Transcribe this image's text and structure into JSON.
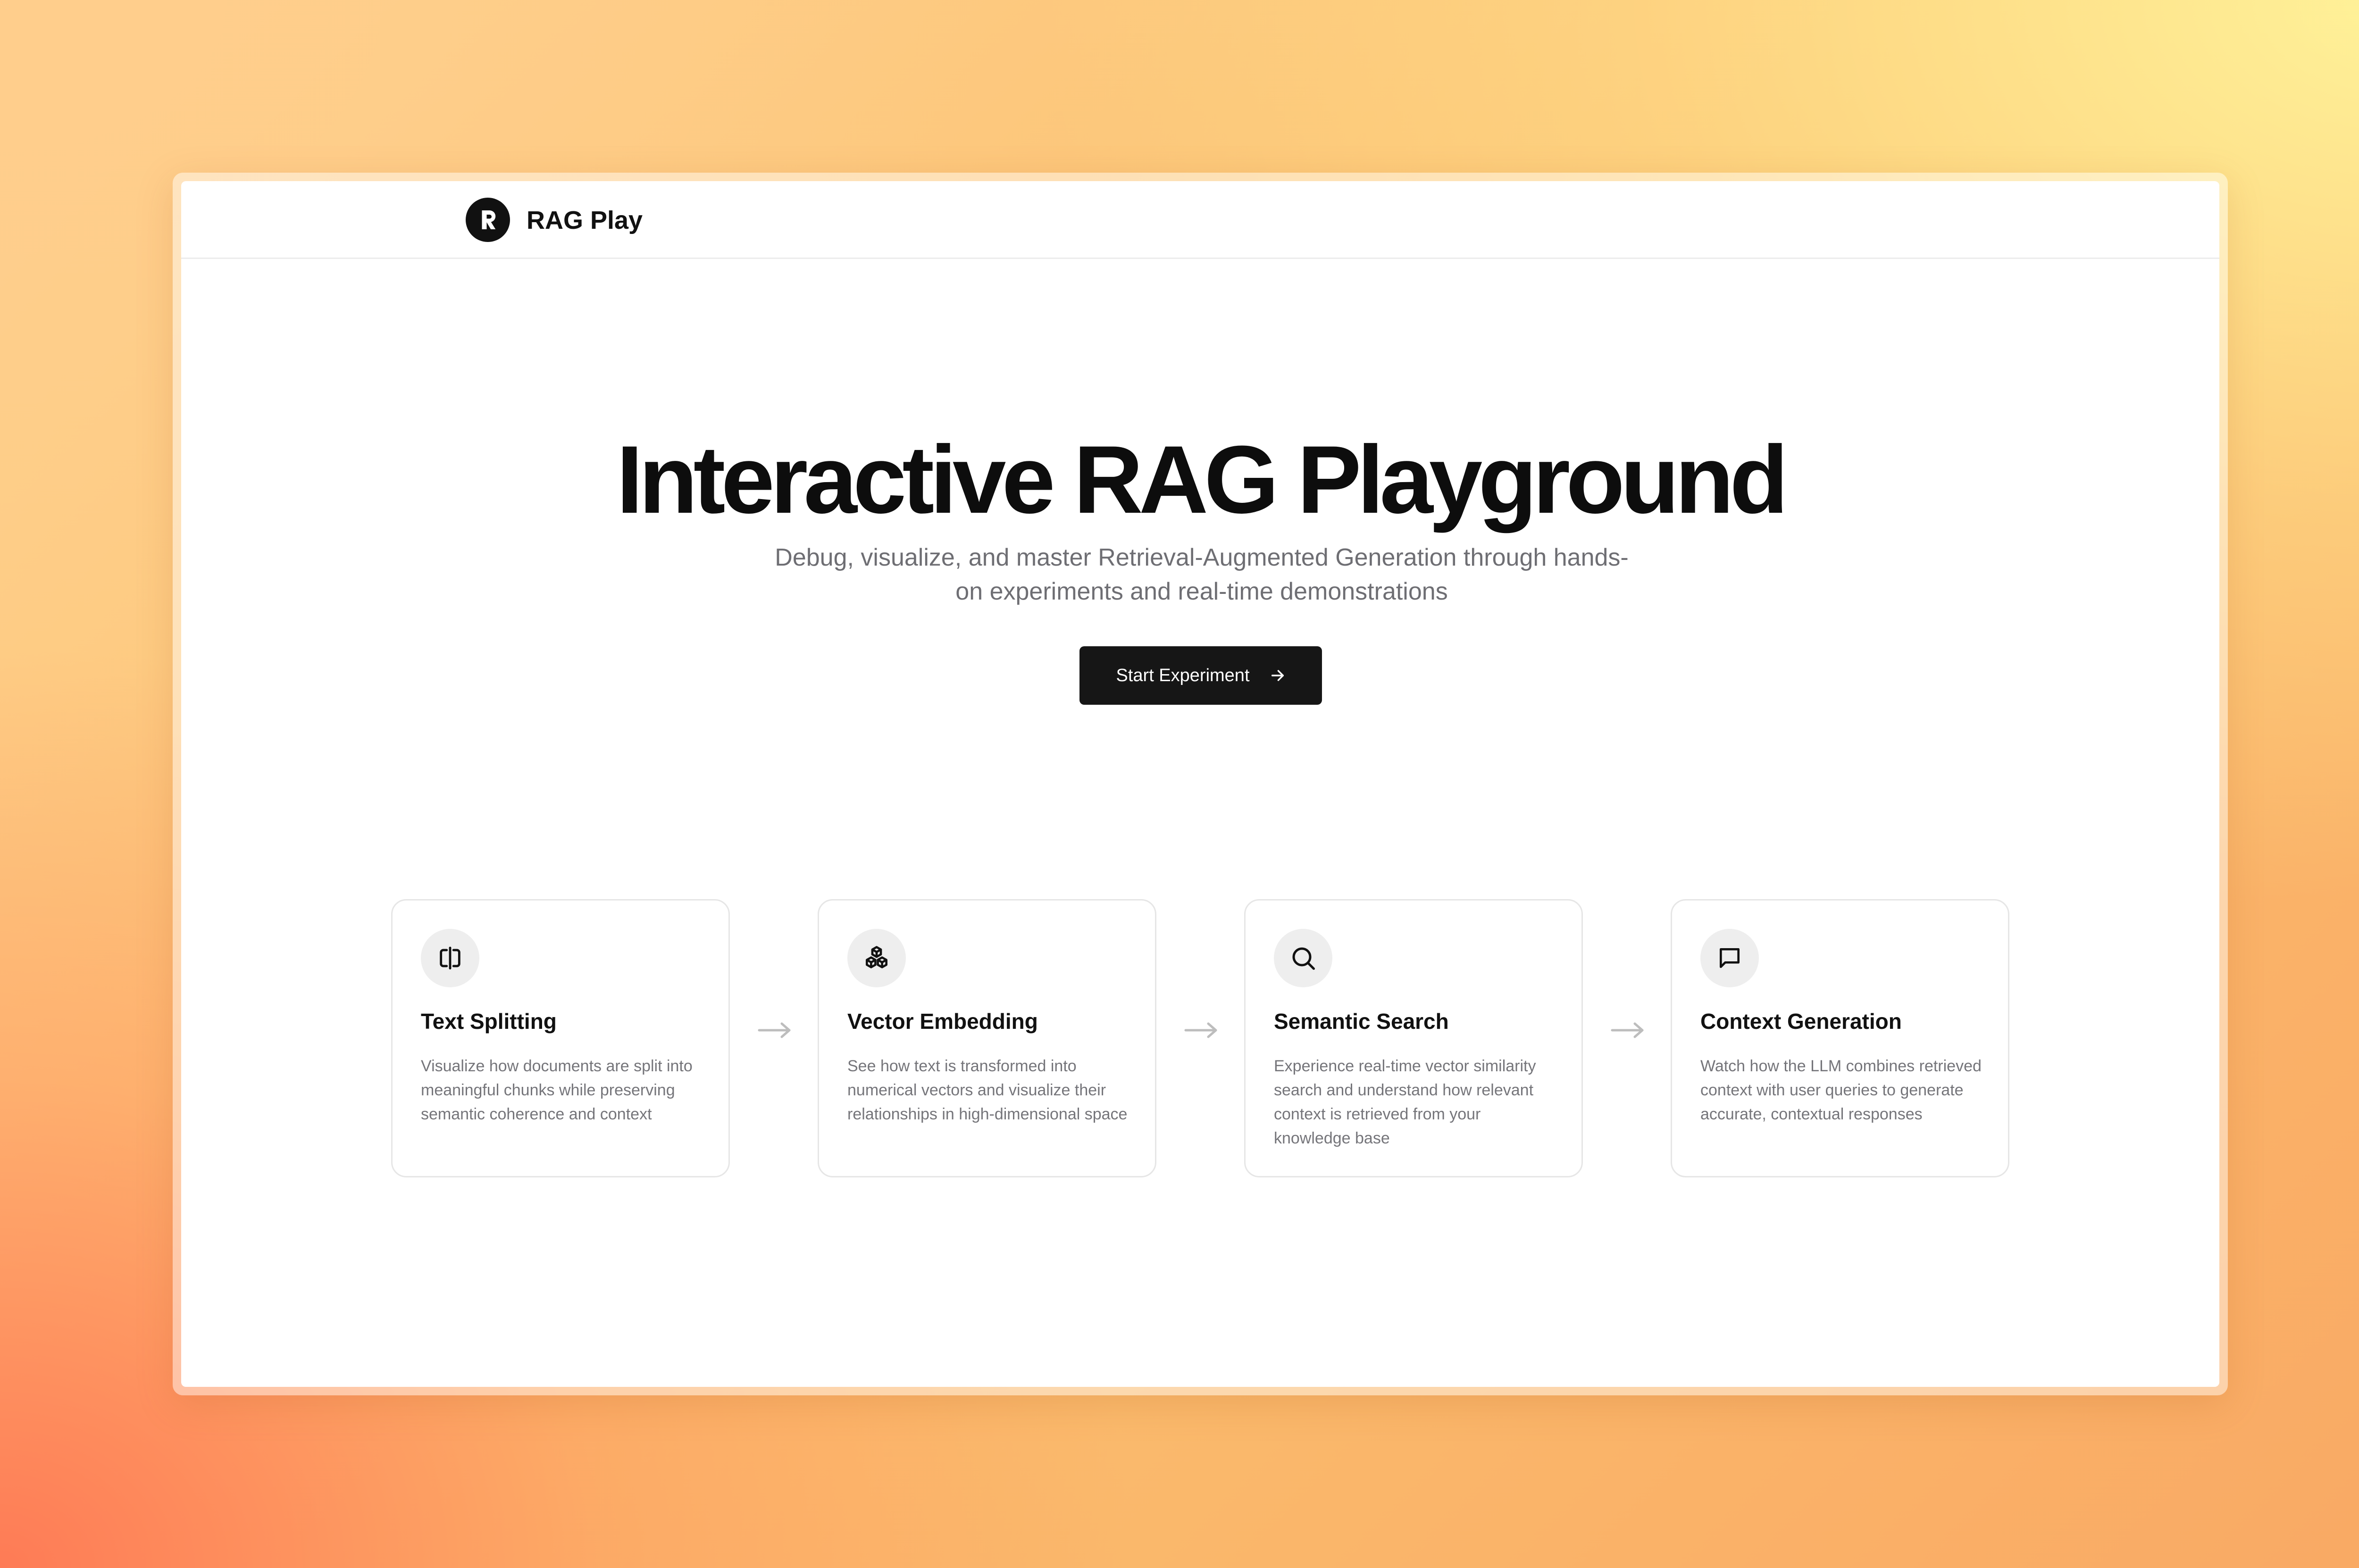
{
  "header": {
    "brand": "RAG Play",
    "logo_icon": "rag-logo-icon"
  },
  "hero": {
    "title": "Interactive RAG Playground",
    "subtitle": "Debug, visualize, and master Retrieval-Augmented Generation through hands-on experiments and real-time demonstrations",
    "cta_label": "Start Experiment",
    "cta_icon": "arrow-right-icon"
  },
  "features": [
    {
      "icon": "split-text-icon",
      "title": "Text Splitting",
      "description": "Visualize how documents are split into meaningful chunks while preserving semantic coherence and context"
    },
    {
      "icon": "embedding-cubes-icon",
      "title": "Vector Embedding",
      "description": "See how text is transformed into numerical vectors and visualize their relationships in high-dimensional space"
    },
    {
      "icon": "search-icon",
      "title": "Semantic Search",
      "description": "Experience real-time vector similarity search and understand how relevant context is retrieved from your knowledge base"
    },
    {
      "icon": "chat-bubble-icon",
      "title": "Context Generation",
      "description": "Watch how the LLM combines retrieved context with user queries to generate accurate, contextual responses"
    }
  ],
  "colors": {
    "primary": "#161616",
    "text": "#111111",
    "muted": "#6e6e73",
    "card_border": "#e6e6e6",
    "icon_bg": "#eeeeee",
    "flow_arrow": "#bdbdbd"
  }
}
